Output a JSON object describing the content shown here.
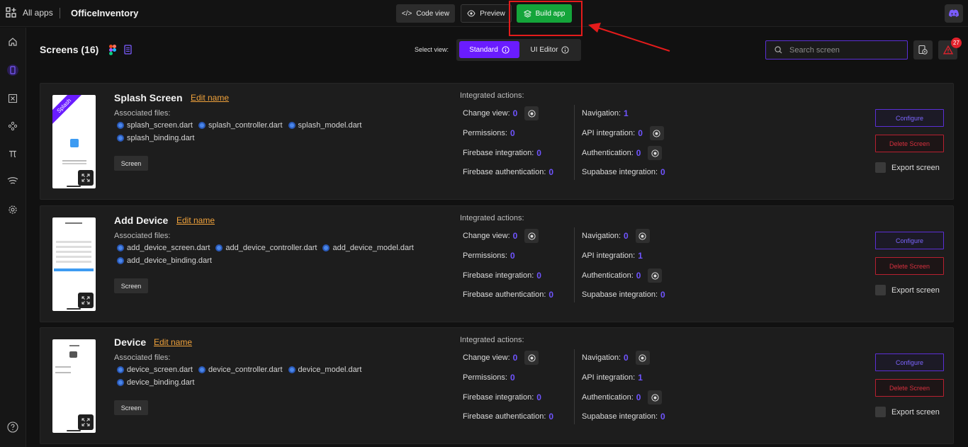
{
  "topbar": {
    "all_apps": "All apps",
    "app_title": "OfficeInventory",
    "code_view": "Code view",
    "preview": "Preview",
    "build_app": "Build app"
  },
  "header": {
    "title": "Screens (16)",
    "select_view_label": "Select view:",
    "view_standard": "Standard",
    "view_ui_editor": "UI Editor",
    "search_placeholder": "Search screen",
    "alert_count": "27"
  },
  "labels": {
    "edit_name": "Edit name",
    "associated_files": "Associated files:",
    "screen_tag": "Screen",
    "integrated_actions": "Integrated actions:",
    "change_view": "Change view:",
    "permissions": "Permissions:",
    "firebase_integration": "Firebase integration:",
    "firebase_auth": "Firebase authentication:",
    "navigation": "Navigation:",
    "api_integration": "API integration:",
    "authentication": "Authentication:",
    "supabase_integration": "Supabase integration:",
    "configure": "Configure",
    "delete_screen": "Delete Screen",
    "export_screen": "Export screen",
    "splash_ribbon": "Splash"
  },
  "cards": [
    {
      "name": "Splash Screen",
      "files": [
        "splash_screen.dart",
        "splash_controller.dart",
        "splash_model.dart",
        "splash_binding.dart"
      ],
      "change_view": "0",
      "permissions": "0",
      "firebase_integration": "0",
      "firebase_auth": "0",
      "navigation": "1",
      "api_integration": "0",
      "authentication": "0",
      "supabase_integration": "0"
    },
    {
      "name": "Add Device",
      "files": [
        "add_device_screen.dart",
        "add_device_controller.dart",
        "add_device_model.dart",
        "add_device_binding.dart"
      ],
      "change_view": "0",
      "permissions": "0",
      "firebase_integration": "0",
      "firebase_auth": "0",
      "navigation": "0",
      "api_integration": "1",
      "authentication": "0",
      "supabase_integration": "0"
    },
    {
      "name": "Device",
      "files": [
        "device_screen.dart",
        "device_controller.dart",
        "device_model.dart",
        "device_binding.dart"
      ],
      "change_view": "0",
      "permissions": "0",
      "firebase_integration": "0",
      "firebase_auth": "0",
      "navigation": "0",
      "api_integration": "1",
      "authentication": "0",
      "supabase_integration": "0"
    }
  ],
  "colors": {
    "accent": "#6a1cff",
    "build_green": "#14a53a",
    "edit_link": "#f0a23b",
    "danger": "#d6303e"
  }
}
